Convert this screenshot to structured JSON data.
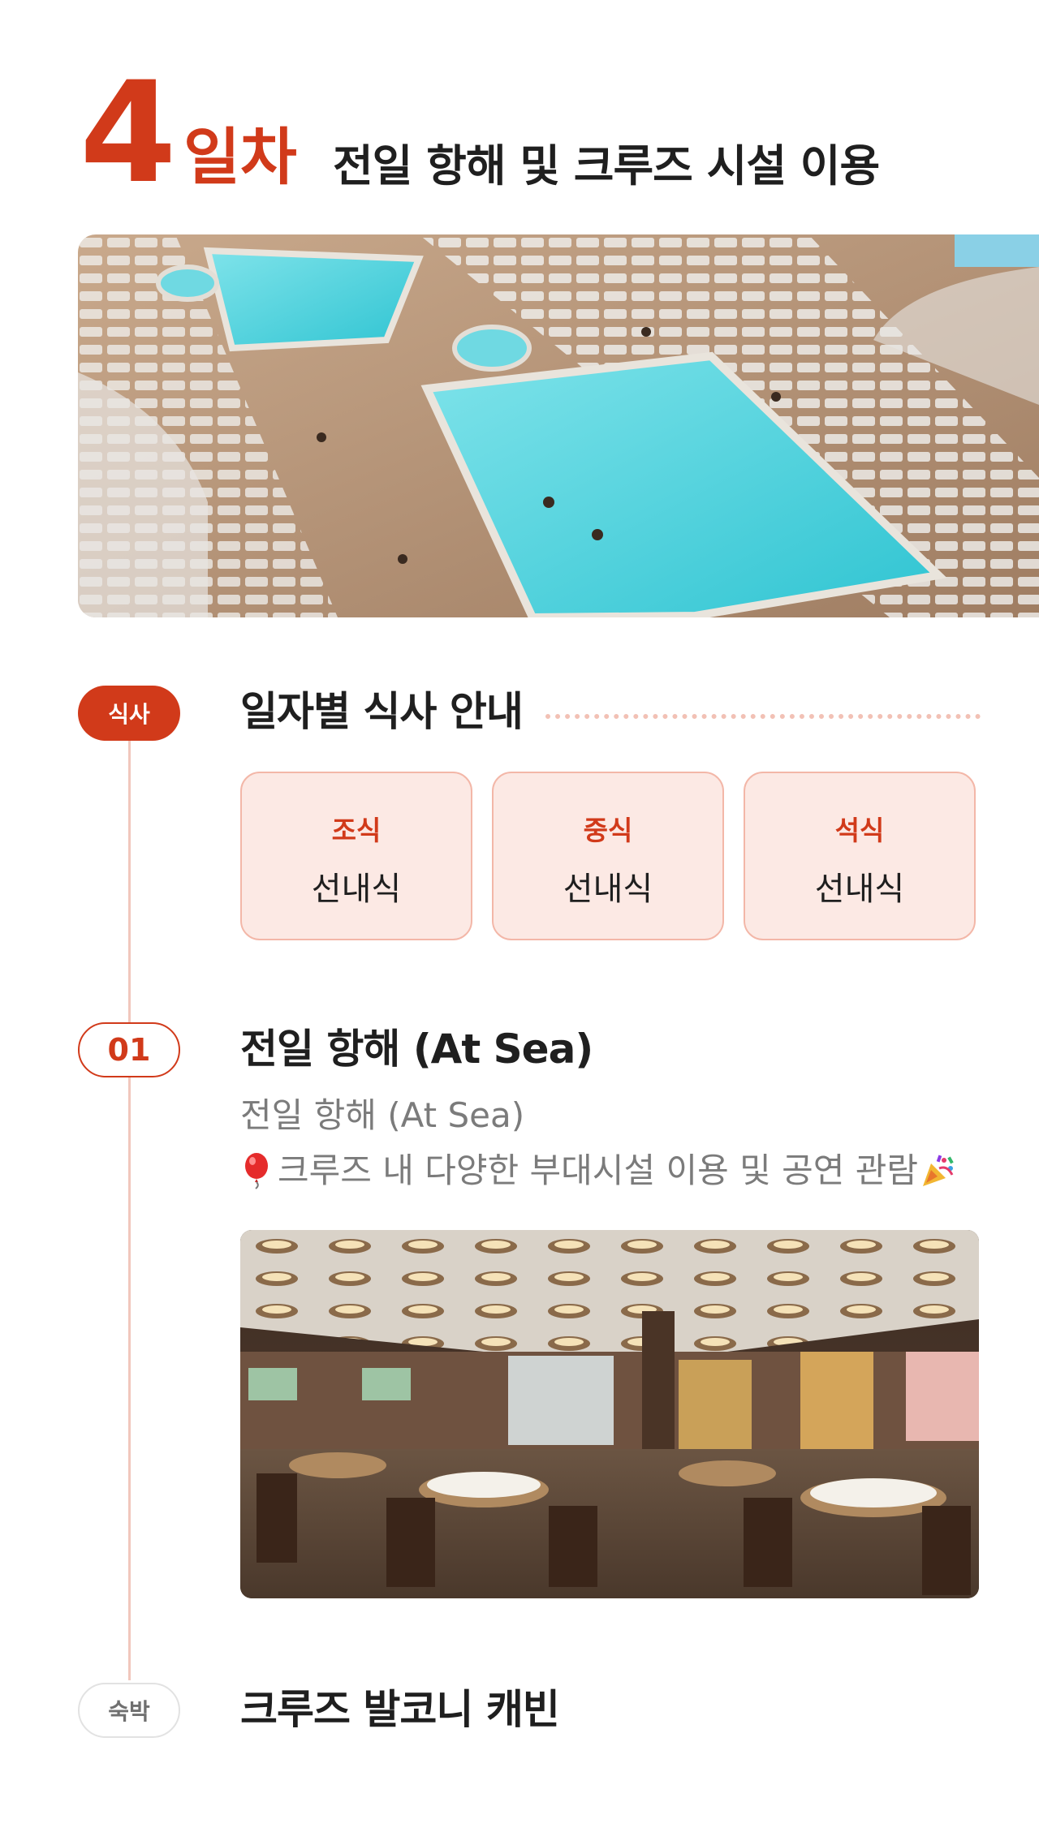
{
  "day": {
    "number": "4",
    "unit": "일차",
    "title": "전일 항해 및 크루즈 시설 이용"
  },
  "meals": {
    "tag": "식사",
    "title": "일자별 식사 안내",
    "items": [
      {
        "label": "조식",
        "value": "선내식"
      },
      {
        "label": "중식",
        "value": "선내식"
      },
      {
        "label": "석식",
        "value": "선내식"
      }
    ]
  },
  "schedule": [
    {
      "number": "01",
      "title": "전일 항해 (At Sea)",
      "subtitle": "전일 항해 (At Sea)",
      "description": "크루즈 내 다양한 부대시설 이용 및 공연 관람",
      "desc_prefix_icon": "balloon-icon",
      "desc_suffix_icon": "party-popper-icon"
    }
  ],
  "lodging": {
    "tag": "숙박",
    "title": "크루즈 발코니 캐빈"
  },
  "colors": {
    "accent": "#d13a1a",
    "card_bg": "#fce9e4",
    "card_border": "#f3b7a8",
    "timeline": "#f1c7bd"
  }
}
